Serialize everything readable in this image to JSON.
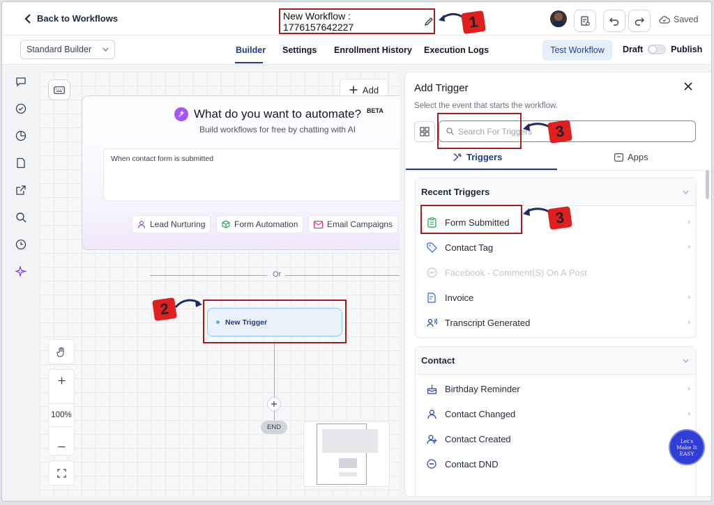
{
  "header": {
    "back_label": "Back to Workflows",
    "workflow_title": "New Workflow : 1776157642227",
    "saved_label": "Saved"
  },
  "subbar": {
    "builder_select": "Standard Builder",
    "tabs": [
      {
        "label": "Builder"
      },
      {
        "label": "Settings"
      },
      {
        "label": "Enrollment History"
      },
      {
        "label": "Execution Logs"
      }
    ],
    "test_button": "Test Workflow",
    "draft_label": "Draft",
    "publish_label": "Publish"
  },
  "canvas": {
    "add_button": "Add",
    "ai_title": "What do you want to automate?",
    "ai_beta": "BETA",
    "ai_subtitle": "Build workflows for free by chatting with AI",
    "ai_input_value": "When contact form is submitted",
    "chips": [
      "Lead Nurturing",
      "Form Automation",
      "Email Campaigns"
    ],
    "or_label": "Or",
    "trigger_node": "New Trigger",
    "end_label": "END",
    "zoom_level": "100%"
  },
  "panel": {
    "title": "Add Trigger",
    "subtitle": "Select the event that starts the workflow.",
    "search_placeholder": "Search For Triggers",
    "tabs": [
      {
        "label": "Triggers"
      },
      {
        "label": "Apps"
      }
    ],
    "recent_section": "Recent Triggers",
    "recent_items": [
      {
        "label": "Form Submitted",
        "icon": "clipboard-icon"
      },
      {
        "label": "Contact Tag",
        "icon": "tag-icon"
      },
      {
        "label": "Facebook - Comment(S) On A Post",
        "icon": "messenger-icon",
        "disabled": true
      },
      {
        "label": "Invoice",
        "icon": "invoice-icon"
      },
      {
        "label": "Transcript Generated",
        "icon": "transcript-icon"
      }
    ],
    "contact_section": "Contact",
    "contact_items": [
      {
        "label": "Birthday Reminder",
        "icon": "cake-icon"
      },
      {
        "label": "Contact Changed",
        "icon": "contact-changed-icon"
      },
      {
        "label": "Contact Created",
        "icon": "user-plus-icon"
      },
      {
        "label": "Contact DND",
        "icon": "dnd-icon"
      }
    ]
  },
  "annotations": {
    "step1": "1",
    "step2": "2",
    "step3": "3",
    "watermark": "Let's Make It EASY"
  },
  "colors": {
    "accent": "#1e3a8a",
    "annotation_red": "#a31d1d",
    "link_blue": "#2563eb",
    "ai_purple": "#a855f7"
  }
}
